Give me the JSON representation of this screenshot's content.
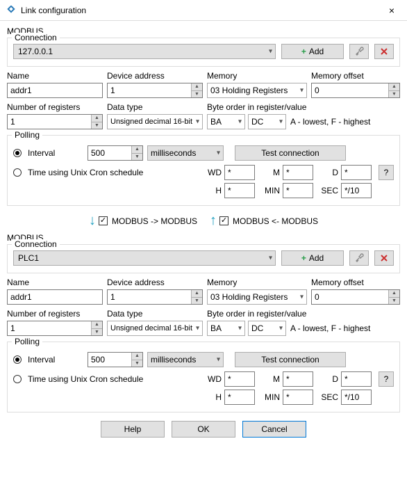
{
  "window": {
    "title": "Link configuration",
    "close": "×"
  },
  "section": {
    "modbus": "MODBUS",
    "connection": "Connection",
    "polling": "Polling"
  },
  "upper": {
    "connection": "127.0.0.1",
    "add": "Add",
    "fields": {
      "name_label": "Name",
      "name_value": "addr1",
      "dev_label": "Device address",
      "dev_value": "1",
      "mem_label": "Memory",
      "mem_value": "03 Holding Registers",
      "off_label": "Memory offset",
      "off_value": "0",
      "numreg_label": "Number of registers",
      "numreg_value": "1",
      "dtype_label": "Data type",
      "dtype_value": "Unsigned decimal 16-bit",
      "byteorder_label": "Byte order in register/value",
      "ba": "BA",
      "dc": "DC",
      "hint": "A - lowest, F - highest"
    },
    "polling": {
      "interval_label": "Interval",
      "interval_value": "500",
      "unit": "milliseconds",
      "test": "Test connection",
      "cron_label": "Time using Unix Cron schedule",
      "wd": "WD",
      "wd_v": "*",
      "m": "M",
      "m_v": "*",
      "d": "D",
      "d_v": "*",
      "h": "H",
      "h_v": "*",
      "min": "MIN",
      "min_v": "*",
      "sec": "SEC",
      "sec_v": "*/10",
      "help": "?"
    }
  },
  "direction": {
    "fwd": "MODBUS -> MODBUS",
    "bwd": "MODBUS <- MODBUS"
  },
  "lower": {
    "connection": "PLC1",
    "add": "Add",
    "fields": {
      "name_label": "Name",
      "name_value": "addr1",
      "dev_label": "Device address",
      "dev_value": "1",
      "mem_label": "Memory",
      "mem_value": "03 Holding Registers",
      "off_label": "Memory offset",
      "off_value": "0",
      "numreg_label": "Number of registers",
      "numreg_value": "1",
      "dtype_label": "Data type",
      "dtype_value": "Unsigned decimal 16-bit",
      "byteorder_label": "Byte order in register/value",
      "ba": "BA",
      "dc": "DC",
      "hint": "A - lowest, F - highest"
    },
    "polling": {
      "interval_label": "Interval",
      "interval_value": "500",
      "unit": "milliseconds",
      "test": "Test connection",
      "cron_label": "Time using Unix Cron schedule",
      "wd": "WD",
      "wd_v": "*",
      "m": "M",
      "m_v": "*",
      "d": "D",
      "d_v": "*",
      "h": "H",
      "h_v": "*",
      "min": "MIN",
      "min_v": "*",
      "sec": "SEC",
      "sec_v": "*/10",
      "help": "?"
    }
  },
  "footer": {
    "help": "Help",
    "ok": "OK",
    "cancel": "Cancel"
  }
}
